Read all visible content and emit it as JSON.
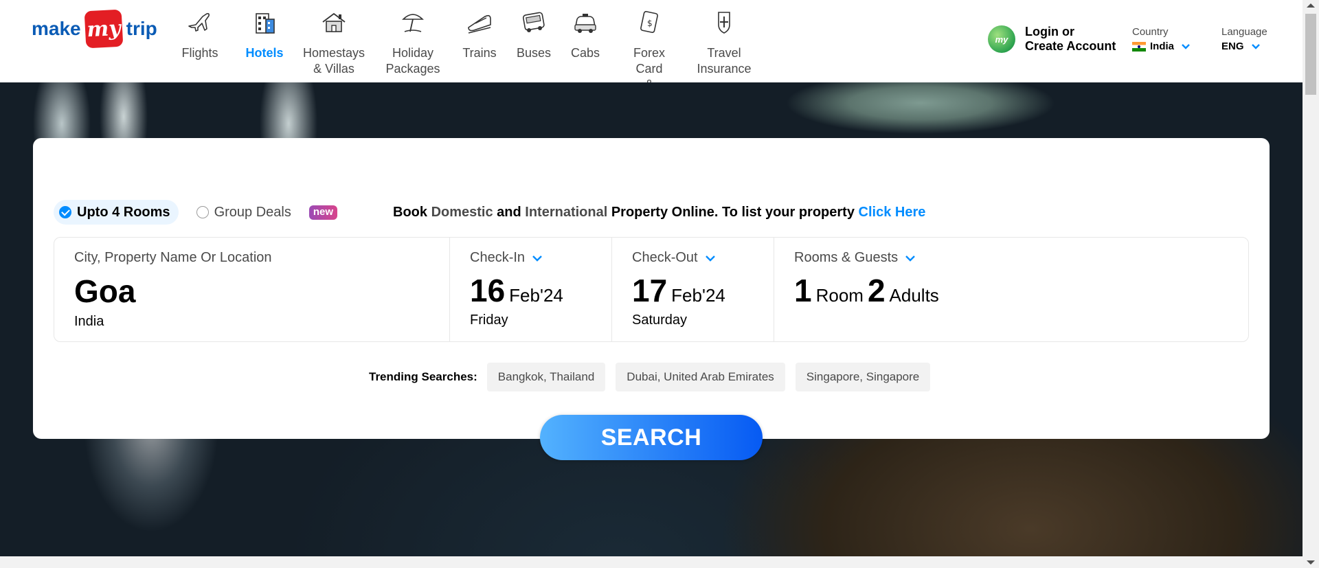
{
  "logo": {
    "part1": "make",
    "part2": "my",
    "part3": "trip"
  },
  "nav": [
    {
      "id": "flights",
      "label": "Flights",
      "icon": "airplane-icon",
      "active": false
    },
    {
      "id": "hotels",
      "label": "Hotels",
      "icon": "hotel-icon",
      "active": true
    },
    {
      "id": "homestays",
      "label": "Homestays\n& Villas",
      "icon": "house-icon",
      "active": false
    },
    {
      "id": "holiday",
      "label": "Holiday\nPackages",
      "icon": "beach-umbrella-icon",
      "active": false
    },
    {
      "id": "trains",
      "label": "Trains",
      "icon": "train-icon",
      "active": false
    },
    {
      "id": "buses",
      "label": "Buses",
      "icon": "bus-icon",
      "active": false
    },
    {
      "id": "cabs",
      "label": "Cabs",
      "icon": "car-icon",
      "active": false
    },
    {
      "id": "forex",
      "label": "Forex Card\n& Currency",
      "icon": "forex-card-icon",
      "active": false
    },
    {
      "id": "insurance",
      "label": "Travel\nInsurance",
      "icon": "insurance-shield-icon",
      "active": false
    }
  ],
  "account": {
    "avatar_text": "my",
    "line1": "Login or",
    "line2": "Create Account"
  },
  "country": {
    "label": "Country",
    "value": "India"
  },
  "language": {
    "label": "Language",
    "value": "ENG"
  },
  "search": {
    "option_rooms": "Upto 4 Rooms",
    "option_group": "Group Deals",
    "new_badge": "new",
    "tagline": {
      "t1": "Book ",
      "t2": "Domestic",
      "t3": " and ",
      "t4": "International",
      "t5": " Property Online. To list your property ",
      "link": "Click Here"
    },
    "city": {
      "label": "City, Property Name Or Location",
      "value": "Goa",
      "sub": "India"
    },
    "checkin": {
      "label": "Check-In",
      "day": "16",
      "month": "Feb'24",
      "weekday": "Friday"
    },
    "checkout": {
      "label": "Check-Out",
      "day": "17",
      "month": "Feb'24",
      "weekday": "Saturday"
    },
    "rooms": {
      "label": "Rooms & Guests",
      "rooms_count": "1",
      "rooms_word": "Room",
      "adults_count": "2",
      "adults_word": "Adults"
    },
    "trending_label": "Trending Searches:",
    "trending": [
      "Bangkok, Thailand",
      "Dubai, United Arab Emirates",
      "Singapore, Singapore"
    ],
    "button": "SEARCH"
  },
  "colors": {
    "accent": "#008cff",
    "brand_red": "#e31e24",
    "brand_blue": "#0a5bb5"
  }
}
